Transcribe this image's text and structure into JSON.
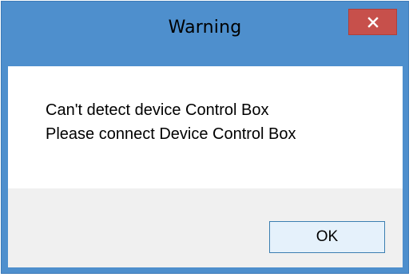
{
  "window": {
    "title": "Warning",
    "close_icon": "close-icon",
    "colors": {
      "frame": "#4e8fcd",
      "close_button": "#c7504b",
      "content_bg": "#ffffff",
      "footer_bg": "#f0f0f0"
    }
  },
  "message": {
    "line1": "Can't detect device Control Box",
    "line2": "Please connect Device Control Box"
  },
  "buttons": {
    "ok_label": "OK"
  }
}
